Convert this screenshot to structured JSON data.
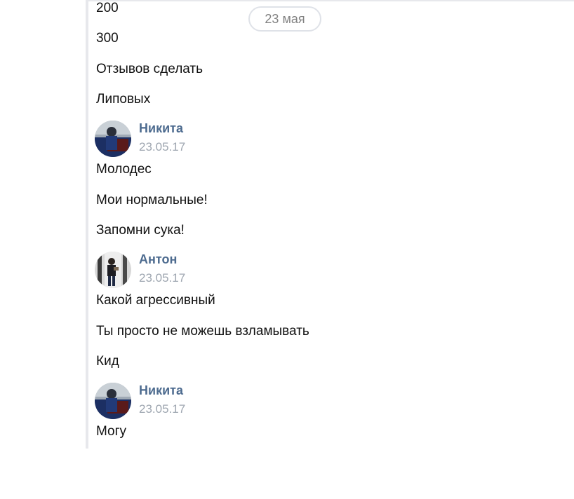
{
  "date_separator": "23 мая",
  "messages": [
    {
      "text": "200"
    },
    {
      "text": "300"
    },
    {
      "text": "Отзывов сделать"
    },
    {
      "text": "Липовых"
    },
    {
      "author": "Никита",
      "time": "23.05.17",
      "lines": [
        "Молодес",
        "Мои нормальные!",
        "Запомни сука!"
      ]
    },
    {
      "author": "Антон",
      "time": "23.05.17",
      "lines": [
        "Какой агрессивный",
        "Ты просто не можешь взламывать",
        "Кид"
      ]
    },
    {
      "author": "Никита",
      "time": "23.05.17",
      "lines": [
        "Могу"
      ]
    }
  ]
}
